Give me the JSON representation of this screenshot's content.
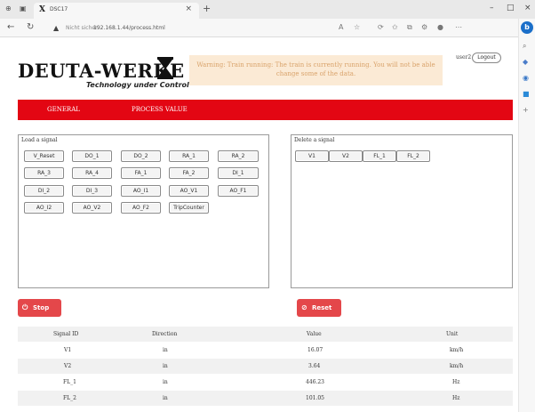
{
  "browser": {
    "tab_title": "DSC17",
    "tab_logo": "X",
    "new_tab": "+",
    "url_security": "Nicht sicher",
    "url_address": "192.168.1.44/process.html",
    "security_icon": "warning-triangle-icon",
    "controls": {
      "minimize": "–",
      "maximize": "□",
      "close": "×"
    }
  },
  "header": {
    "logo_text": "DEUTA-WERKE",
    "tagline": "Technology under Control",
    "warning_text": "Warning: Train running: The train is currently running. You will not be able change some of the data.",
    "user": "user2",
    "logout_label": "Logout"
  },
  "menu": {
    "items": [
      "GENERAL",
      "PROCESS VALUE"
    ]
  },
  "load_panel": {
    "title": "Load a signal",
    "buttons": [
      "V_Reset",
      "DO_1",
      "DO_2",
      "RA_1",
      "RA_2",
      "RA_3",
      "RA_4",
      "FA_1",
      "FA_2",
      "DI_1",
      "DI_2",
      "DI_3",
      "AO_I1",
      "AO_V1",
      "AO_F1",
      "AO_I2",
      "AO_V2",
      "AO_F2",
      "TripCounter"
    ]
  },
  "delete_panel": {
    "title": "Delete a signal",
    "buttons": [
      "V1",
      "V2",
      "FL_1",
      "FL_2"
    ]
  },
  "actions": {
    "stop_label": "Stop",
    "reset_label": "Reset",
    "colors": {
      "button": "#e4474a",
      "menu": "#e30613",
      "warning_bg": "#fbead5"
    }
  },
  "table": {
    "headers": [
      "Signal ID",
      "Direction",
      "Value",
      "Unit"
    ],
    "rows": [
      [
        "V1",
        "in",
        "16.07",
        "km/h"
      ],
      [
        "V2",
        "in",
        "3.64",
        "km/h"
      ],
      [
        "FL_1",
        "in",
        "446.23",
        "Hz"
      ],
      [
        "FL_2",
        "in",
        "101.05",
        "Hz"
      ]
    ]
  }
}
